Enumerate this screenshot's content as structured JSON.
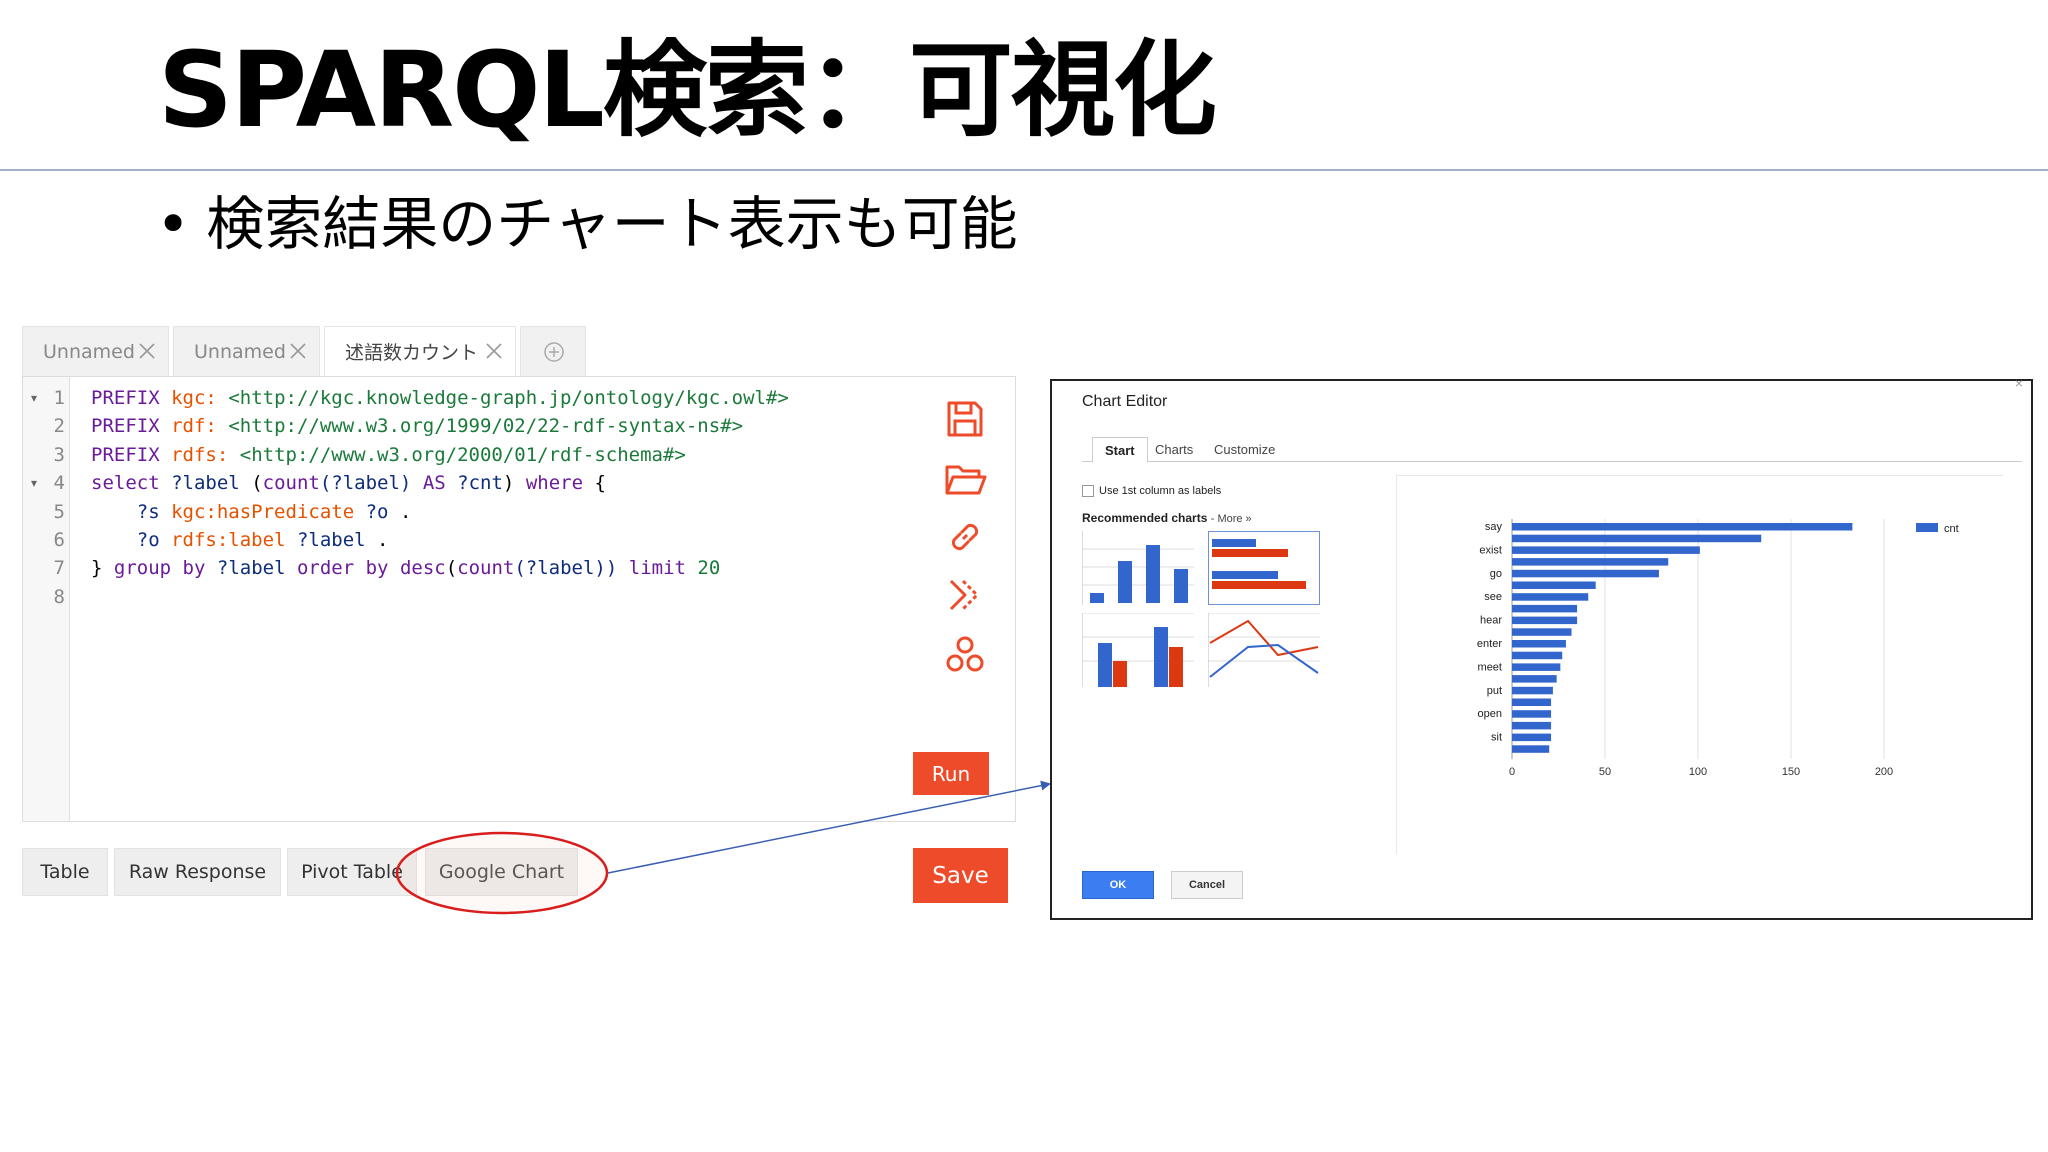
{
  "slide": {
    "title": "SPARQL検索：可視化",
    "bullet_mark": "•",
    "bullet": "検索結果のチャート表示も可能"
  },
  "query_tabs": [
    {
      "label": "Unnamed",
      "active": false
    },
    {
      "label": "Unnamed",
      "active": false
    },
    {
      "label": "述語数カウント",
      "active": true
    }
  ],
  "editor": {
    "line_numbers": [
      "1",
      "2",
      "3",
      "4",
      "5",
      "6",
      "7",
      "8"
    ],
    "folds": {
      "line1": "▾",
      "line4": "▾"
    },
    "lines": {
      "l1": {
        "kw": "PREFIX",
        "pfx": "kgc:",
        "uri": "<http://kgc.knowledge-graph.jp/ontology/kgc.owl#>"
      },
      "l2": {
        "kw": "PREFIX",
        "pfx": "rdf:",
        "uri": "<http://www.w3.org/1999/02/22-rdf-syntax-ns#>"
      },
      "l3": {
        "kw": "PREFIX",
        "pfx": "rdfs:",
        "uri": "<http://www.w3.org/2000/01/rdf-schema#>"
      },
      "l4": {
        "kw1": "select",
        "v1": "?label",
        "t1": "(",
        "kw2": "count",
        "t2": "(?label)",
        "kw3": "AS",
        "v2": "?cnt",
        "t3": ")",
        "kw4": "where",
        "t4": "{"
      },
      "l5": {
        "v1": "?s",
        "pfx": "kgc:hasPredicate",
        "v2": "?o",
        "t1": "."
      },
      "l6": {
        "v1": "?o",
        "pfx": "rdfs:label",
        "v2": "?label",
        "t1": "."
      },
      "l7": {
        "t1": "}",
        "kw1": "group by",
        "v1": "?label",
        "kw2": "order by",
        "kw3": "desc",
        "t2": "(",
        "kw4": "count",
        "t3": "(?label))",
        "kw5": "limit",
        "num": "20"
      }
    },
    "side_icons": [
      "save-icon",
      "folder-open-icon",
      "link-icon",
      "chevrons-right-icon",
      "nodes-icon"
    ],
    "run_label": "Run"
  },
  "result_tabs": [
    "Table",
    "Raw Response",
    "Pivot Table",
    "Google Chart"
  ],
  "save_label": "Save",
  "chart_editor": {
    "title": "Chart Editor",
    "close": "×",
    "tabs": [
      "Start",
      "Charts",
      "Customize"
    ],
    "use_first_column": "Use 1st column as labels",
    "recommended": "Recommended charts",
    "more": "- More »",
    "ok": "OK",
    "cancel": "Cancel"
  },
  "colors": {
    "accent_red": "#ee4b2b",
    "bar_blue": "#3366cc",
    "series_red": "#dc3912",
    "ok_blue": "#3d7df2"
  },
  "chart_data": {
    "type": "bar",
    "orientation": "horizontal",
    "categories": [
      "say",
      "",
      "exist",
      "",
      "go",
      "",
      "see",
      "",
      "hear",
      "",
      "enter",
      "",
      "meet",
      "",
      "put",
      "",
      "open",
      "",
      "sit",
      ""
    ],
    "series": [
      {
        "name": "cnt",
        "values": [
          183,
          134,
          101,
          84,
          79,
          45,
          41,
          35,
          35,
          32,
          29,
          27,
          26,
          24,
          22,
          21,
          21,
          21,
          21,
          20
        ]
      }
    ],
    "xlim": [
      0,
      200
    ],
    "xticks": [
      "0",
      "50",
      "100",
      "150",
      "200"
    ],
    "grid": true,
    "legend": "right"
  }
}
